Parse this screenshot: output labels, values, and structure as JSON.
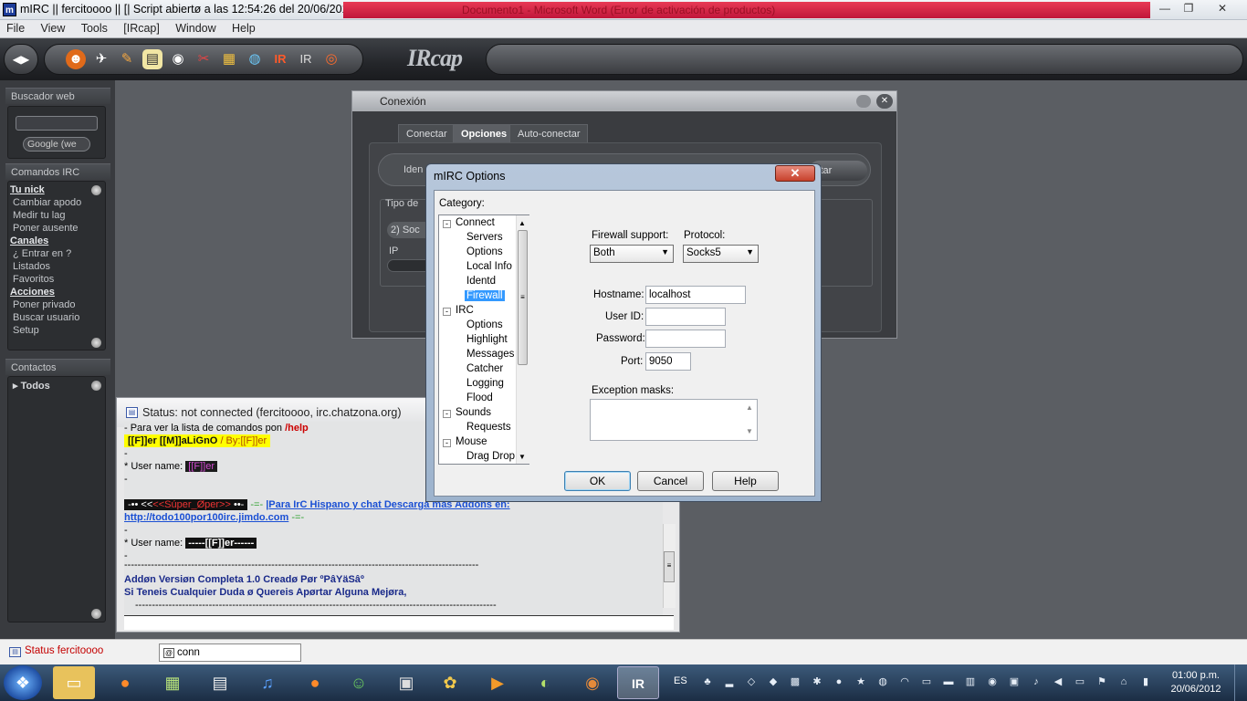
{
  "window": {
    "title": "mIRC || fercitoooo || [| Script abiertø a las 12:54:26 del 20/06/2012 .",
    "banner": "Documento1 - Microsoft Word (Error de activación de productos)",
    "min": "—",
    "max": "❐",
    "close": "✕"
  },
  "menu": [
    "File",
    "View",
    "Tools",
    "[IRcap]",
    "Window",
    "Help"
  ],
  "toolbar": {
    "logo": "IRcap"
  },
  "sidebar": {
    "buscador_title": "Buscador web",
    "search_value": "",
    "engine": "Google (we",
    "comandos_title": "Comandos IRC",
    "comandos": [
      {
        "text": "Tu nick",
        "head": true
      },
      {
        "text": "Cambiar apodo"
      },
      {
        "text": "Medir tu lag"
      },
      {
        "text": "Poner ausente"
      },
      {
        "text": "Canales",
        "head": true
      },
      {
        "text": "¿ Entrar en ?"
      },
      {
        "text": "Listados"
      },
      {
        "text": "Favoritos"
      },
      {
        "text": "Acciones",
        "head": true
      },
      {
        "text": "Poner privado"
      },
      {
        "text": "Buscar usuario"
      },
      {
        "text": "Setup"
      }
    ],
    "contactos_title": "Contactos",
    "contactos_item": "Todos"
  },
  "conexion": {
    "title": "Conexión",
    "tabs": [
      "Conectar",
      "Opciones",
      "Auto-conectar"
    ],
    "active_tab": "Opciones",
    "ident_label": "Iden",
    "edit_btn": "itar",
    "tipo_label": "Tipo de",
    "socks_value": "2) Soc",
    "ip_label": "IP"
  },
  "status": {
    "title": "Status: not connected (fercitoooo, irc.chatzona.org)",
    "help_line": "- Para ver la lista de comandos pon",
    "help_cmd": "/help",
    "banner1": "[[F]]er [[M]]aLiGnO",
    "banner1b": "/ By:[[F]]er",
    "dash": "-",
    "user_label": "* User name:",
    "user1": "[[F]]er",
    "super_oper": "<<Súper_Øper>>",
    "line_text": "|Para IrC Hispano y chat Descarga mas Addons en:",
    "url": "http://todo100por100irc.jimdo.com",
    "user2": "-----[[F]]er------",
    "sep": "----------------------------------------------------------------------------------------------------------",
    "addon1": "Addøn Versiøn Completa 1.0 Creadø Pør  ºPâYäSâº",
    "addon2": "Si Teneis Cualquier Duda ø Quereis Apørtar Alguna Mejøra,",
    "sep2": "------------------------------------------------------------------------------------------------------------"
  },
  "options": {
    "title": "mIRC Options",
    "close": "✕",
    "category_label": "Category:",
    "tree": [
      {
        "text": "Connect",
        "level": 0,
        "exp": "-"
      },
      {
        "text": "Servers",
        "level": 1
      },
      {
        "text": "Options",
        "level": 1
      },
      {
        "text": "Local Info",
        "level": 1
      },
      {
        "text": "Identd",
        "level": 1
      },
      {
        "text": "Firewall",
        "level": 1,
        "selected": true
      },
      {
        "text": "IRC",
        "level": 0,
        "exp": "-"
      },
      {
        "text": "Options",
        "level": 1
      },
      {
        "text": "Highlight",
        "level": 1
      },
      {
        "text": "Messages",
        "level": 1
      },
      {
        "text": "Catcher",
        "level": 1
      },
      {
        "text": "Logging",
        "level": 1
      },
      {
        "text": "Flood",
        "level": 1
      },
      {
        "text": "Sounds",
        "level": 0,
        "exp": "-"
      },
      {
        "text": "Requests",
        "level": 1
      },
      {
        "text": "Mouse",
        "level": 0,
        "exp": "-"
      },
      {
        "text": "Drag Drop",
        "level": 1
      }
    ],
    "firewall_support_label": "Firewall support:",
    "firewall_support_value": "Both",
    "protocol_label": "Protocol:",
    "protocol_value": "Socks5",
    "hostname_label": "Hostname:",
    "hostname_value": "localhost",
    "userid_label": "User ID:",
    "userid_value": "",
    "password_label": "Password:",
    "password_value": "",
    "port_label": "Port:",
    "port_value": "9050",
    "exception_label": "Exception masks:",
    "exception_value": "",
    "ok": "OK",
    "cancel": "Cancel",
    "help": "Help"
  },
  "switchbar": {
    "status_item": "Status fercitoooo",
    "conn_item": "conn"
  },
  "taskbar": {
    "lang": "ES",
    "time": "01:00 p.m.",
    "date": "20/06/2012"
  }
}
